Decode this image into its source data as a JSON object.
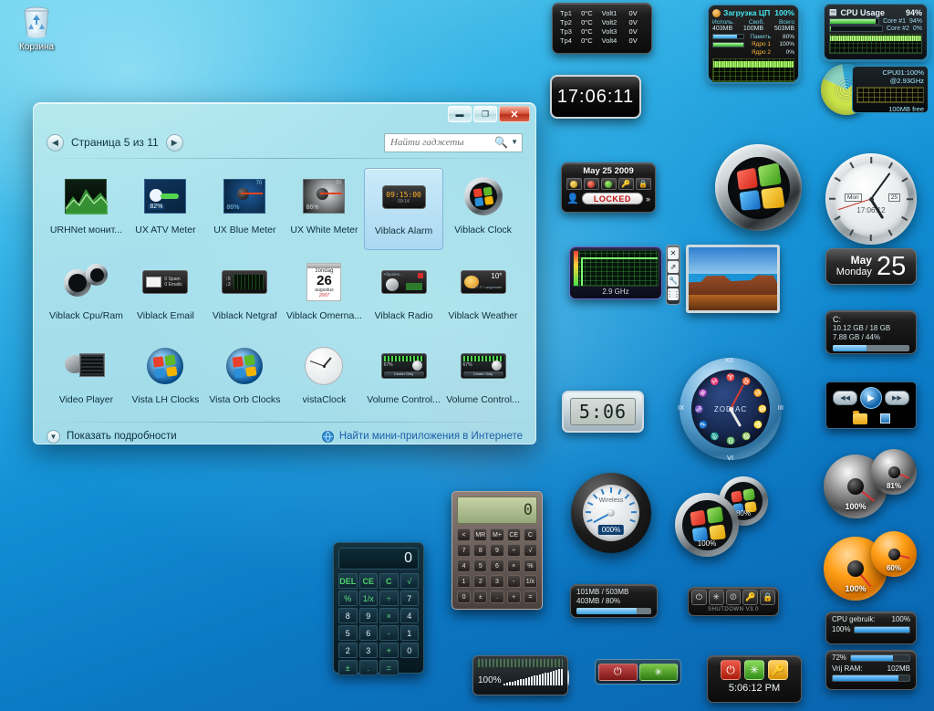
{
  "desktop": {
    "recycle_bin_label": "Корзина"
  },
  "gallery": {
    "window_title": "",
    "page_label": "Страница 5 из 11",
    "prev_icon": "◀",
    "next_icon": "▶",
    "search_placeholder": "Найти гаджеты",
    "search_icon": "search-icon",
    "minimize_label": "▬",
    "maximize_label": "❐",
    "close_label": "✕",
    "details_label": "Показать подробности",
    "online_label": "Найти мини-приложения в Интернете",
    "items": [
      {
        "name": "URHNet монит...",
        "selected": false
      },
      {
        "name": "UX ATV Meter",
        "value": "82%",
        "selected": false
      },
      {
        "name": "UX Blue Meter",
        "value": "86%",
        "selected": false
      },
      {
        "name": "UX White Meter",
        "value": "86%",
        "selected": false
      },
      {
        "name": "Viblack Alarm",
        "value": "09:15:00",
        "sub": "09:14",
        "selected": true
      },
      {
        "name": "Viblack Clock",
        "selected": false
      },
      {
        "name": "Viblack Cpu/Ram",
        "selected": false
      },
      {
        "name": "Viblack Email",
        "value": "0 Emails",
        "selected": false
      },
      {
        "name": "Viblack Netgraf",
        "selected": false
      },
      {
        "name": "Viblack Omerna...",
        "value": "26",
        "sub": "zondag",
        "sub2": "augustus",
        "selected": false
      },
      {
        "name": "Viblack Radio",
        "selected": false
      },
      {
        "name": "Viblack Weather",
        "value": "10°",
        "selected": false
      },
      {
        "name": "Video Player",
        "selected": false
      },
      {
        "name": "Vista LH Clocks",
        "selected": false
      },
      {
        "name": "Vista Orb Clocks",
        "selected": false
      },
      {
        "name": "vistaClock",
        "selected": false
      },
      {
        "name": "Volume Control...",
        "value": "67%",
        "sub": "Center Only",
        "selected": false
      },
      {
        "name": "Volume Control...",
        "value": "67%",
        "sub": "Center Only",
        "selected": false
      }
    ]
  },
  "gadgets": {
    "temps": {
      "rows": [
        {
          "sensor": "Tp1",
          "temp": "0°C",
          "volt_label": "Volt1",
          "volt": "0V"
        },
        {
          "sensor": "Tp2",
          "temp": "0°C",
          "volt_label": "Volt2",
          "volt": "0V"
        },
        {
          "sensor": "Tp3",
          "temp": "0°C",
          "volt_label": "Volt3",
          "volt": "0V"
        },
        {
          "sensor": "Tp4",
          "temp": "0°C",
          "volt_label": "Volt4",
          "volt": "0V"
        }
      ]
    },
    "big_clock": {
      "time": "17:06:11"
    },
    "ru_cpu": {
      "title": "Загрузка ЦП",
      "title_pct": "100%",
      "col_used": "Исполь.",
      "col_free": "Своб.",
      "col_total": "Всего",
      "used": "403MB",
      "free": "100MB",
      "total": "503MB",
      "mem_label": "Память",
      "mem_pct": "80%",
      "core1_label": "Ядро 1",
      "core1_pct": "100%",
      "core2_label": "Ядро 2",
      "core2_pct": "0%"
    },
    "cpu_usage": {
      "title": "CPU Usage",
      "total_pct": "94%",
      "core1_label": "Core #1",
      "core1_pct": "94%",
      "core2_label": "Core #2",
      "core2_pct": "0%"
    },
    "cpu01": {
      "line1": "CPU01:100%",
      "line2": "@2.93GHz",
      "line3": "100MB free"
    },
    "locked": {
      "date": "May 25 2009",
      "status": "LOCKED",
      "more_icon": "»"
    },
    "ghz": {
      "caption": "2.9 GHz"
    },
    "tools": {
      "close_icon": "✕",
      "expand_icon": "⇗",
      "settings_icon": "🔧",
      "drag_icon": "⋮⋮"
    },
    "analog_clock": {
      "day": "Mon",
      "date_num": "25",
      "digital": "17:06:12"
    },
    "day_box": {
      "month": "May",
      "weekday": "Monday",
      "day": "25"
    },
    "disk": {
      "drive": "C:",
      "line1": "10.12 GB / 18 GB",
      "line2": "7.88 GB / 44%",
      "fill_pct": 44
    },
    "media": {
      "prev_icon": "◀◀",
      "play_icon": "▶",
      "next_icon": "▶▶",
      "folder_icon": "folder-icon",
      "stop_icon": "stop-icon"
    },
    "silver_gauges": {
      "big": "100%",
      "small": "81%"
    },
    "orange_gauges": {
      "big": "100%",
      "small": "60%"
    },
    "zodiac": {
      "label": "ZODIAC",
      "numerals": [
        "XII",
        "III",
        "VI",
        "IX"
      ]
    },
    "digital_small": {
      "time": "5:06"
    },
    "wireless": {
      "label": "Wireless",
      "value": "000%"
    },
    "orb_meters": {
      "big": "100%",
      "small": "80%"
    },
    "memory": {
      "line1": "101MB / 503MB",
      "line2": "403MB / 80%",
      "fill_pct": 80
    },
    "shutdown": {
      "caption": "SHUTDOWN V3.0",
      "keys": [
        "⏻",
        "✳",
        "⏼",
        "🔑",
        "🔒"
      ]
    },
    "power_pair": {
      "off_icon": "⏻",
      "restart_icon": "✳"
    },
    "clock_buttons": {
      "time": "5:06:12 PM",
      "keys": [
        "⏻",
        "✳",
        "🔑"
      ]
    },
    "cpu_gebruik": {
      "label": "CPU gebruik:",
      "value": "100%",
      "bar_label": "100%",
      "fill_pct": 100
    },
    "vrij_ram": {
      "top_pct": "72%",
      "label": "Vrij RAM:",
      "value": "102MB",
      "top_fill_pct": 72,
      "fill_pct": 86
    },
    "calc_dark": {
      "display": "0",
      "keys": [
        "DEL",
        "CE",
        "C",
        "√",
        "%",
        "1/x",
        "÷",
        "7",
        "8",
        "9",
        "×",
        "4",
        "5",
        "6",
        "-",
        "1",
        "2",
        "3",
        "+",
        "0",
        "±",
        ".",
        "="
      ]
    },
    "calc_beige": {
      "display": "0",
      "keys": [
        "<",
        "MR",
        "M+",
        "CE",
        "C",
        "7",
        "8",
        "9",
        "÷",
        "√",
        "4",
        "5",
        "6",
        "×",
        "%",
        "1",
        "2",
        "3",
        "-",
        "1/x",
        "0",
        "±",
        ".",
        "+",
        "="
      ]
    },
    "volume": {
      "pct": "100%"
    }
  }
}
